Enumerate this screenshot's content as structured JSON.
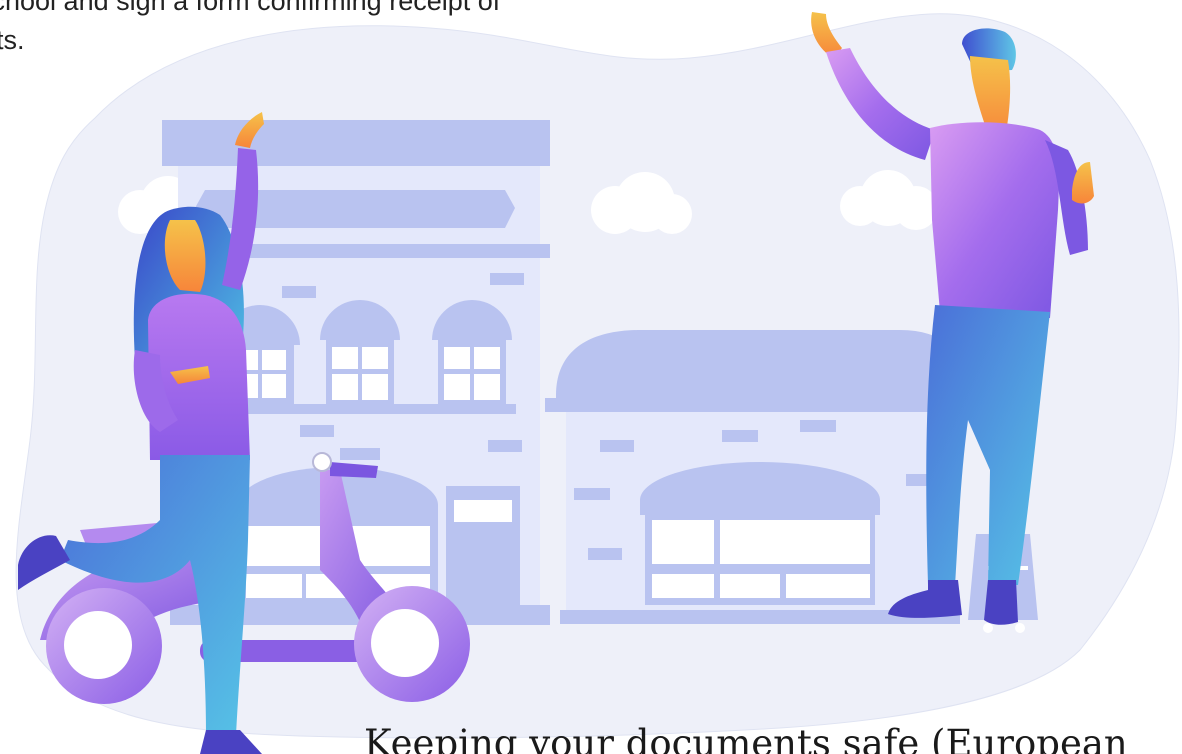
{
  "intro": {
    "line1": "school and sign a form confirming receipt of",
    "line2": "ts."
  },
  "heading": {
    "text": "Keeping your documents safe (European"
  },
  "colors": {
    "blob_background": "#eef0f9",
    "building": "#b9c3f0",
    "building_light": "#e4e8fb",
    "window": "#ffffff",
    "shirt": "#a066ec",
    "jeans": "#4e9ad9",
    "skin": "#f7a23e",
    "hair": "#3b5dd6",
    "scooter": "#9b6ce8",
    "shoes": "#4a42c2"
  }
}
